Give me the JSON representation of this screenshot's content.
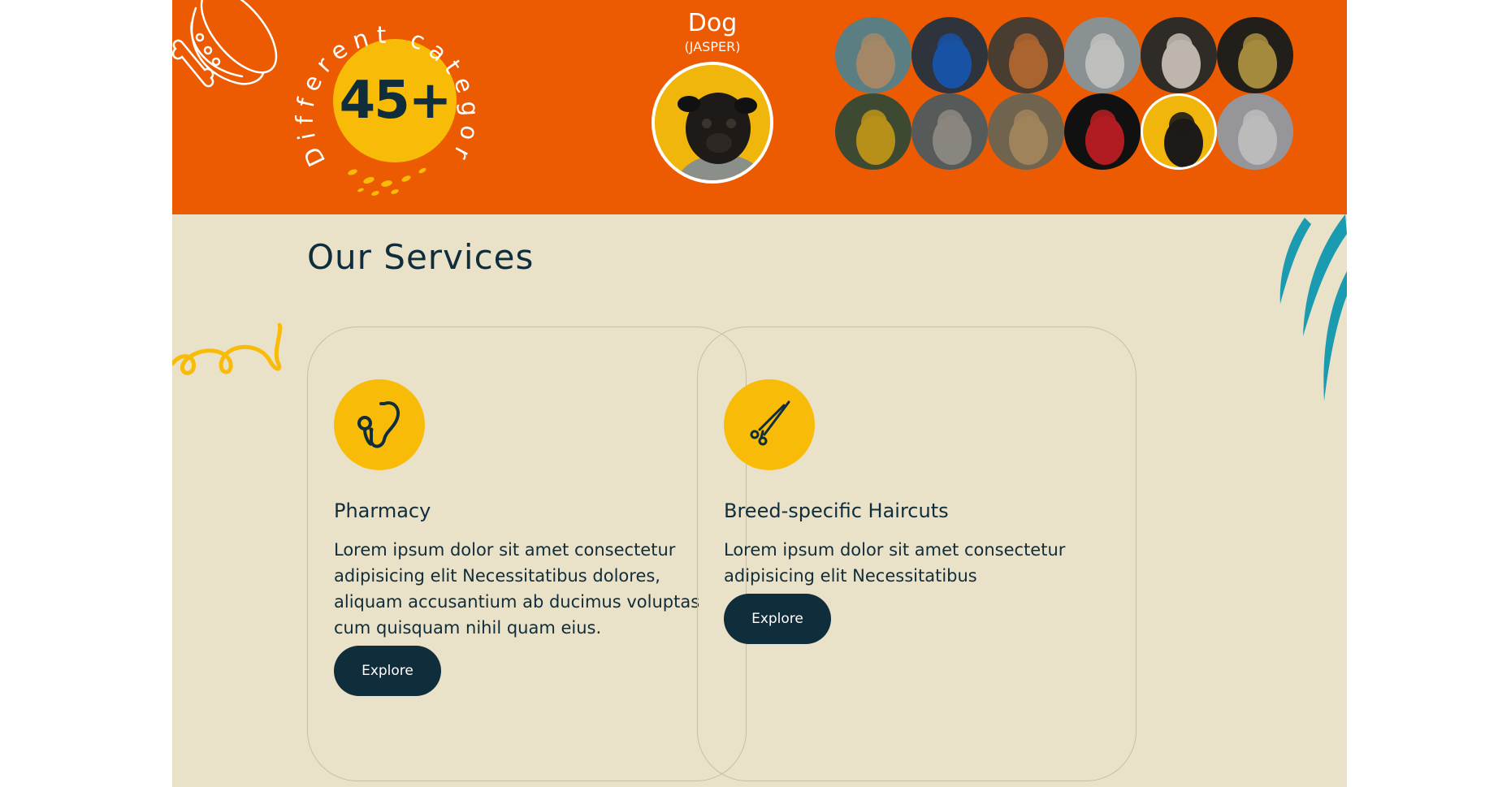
{
  "hero": {
    "badge_number": "45+",
    "badge_text": "Different category",
    "featured_name": "Dog",
    "featured_sub": "(JASPER)",
    "thumbnails": [
      {
        "name": "kitten",
        "icon": "cat-thumbnail"
      },
      {
        "name": "bluebird",
        "icon": "bird-thumbnail"
      },
      {
        "name": "fox",
        "icon": "fox-thumbnail"
      },
      {
        "name": "white-cat",
        "icon": "cat-thumbnail"
      },
      {
        "name": "guinea-pig",
        "icon": "guinea-pig-thumbnail"
      },
      {
        "name": "cockatiel",
        "icon": "bird-thumbnail"
      },
      {
        "name": "macaw",
        "icon": "parrot-thumbnail"
      },
      {
        "name": "tabby-cat",
        "icon": "cat-thumbnail"
      },
      {
        "name": "lion",
        "icon": "lion-thumbnail"
      },
      {
        "name": "lory",
        "icon": "parrot-thumbnail"
      },
      {
        "name": "pug",
        "icon": "dog-thumbnail"
      },
      {
        "name": "rabbit",
        "icon": "rabbit-thumbnail"
      }
    ]
  },
  "services": {
    "title": "Our Services",
    "cards": [
      {
        "icon": "stethoscope-icon",
        "title": "Pharmacy",
        "text": "Lorem ipsum dolor sit amet consectetur adipisicing elit Necessitatibus dolores, aliquam accusantium ab ducimus voluptas cum quisquam nihil quam eius.",
        "button": "Explore"
      },
      {
        "icon": "scissors-icon",
        "title": "Breed-specific Haircuts",
        "text": "Lorem ipsum dolor sit amet consectetur adipisicing elit Necessitatibus",
        "button": "Explore"
      }
    ]
  },
  "colors": {
    "hero_bg": "#ec5b02",
    "accent_yellow": "#f8bc08",
    "dark_navy": "#0f2d3b",
    "cream_bg": "#e9e1c8",
    "teal_claw": "#1a9bb0"
  }
}
